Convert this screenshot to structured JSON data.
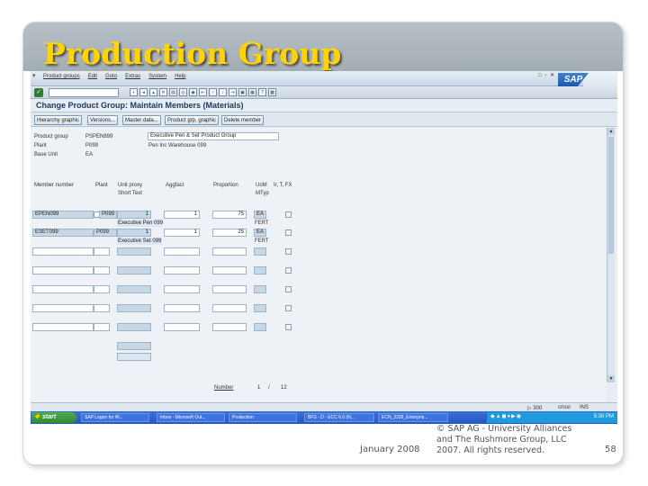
{
  "slide": {
    "title": "Production Group",
    "footer_date": "January 2008",
    "footer_copyright_lines": [
      "© SAP AG - University Alliances",
      "and The Rushmore Group, LLC",
      "2007. All rights reserved."
    ],
    "page_number": "58",
    "title_color": "#ffd400"
  },
  "menubar": {
    "items": [
      "Product groups",
      "Edit",
      "Goto",
      "Extras",
      "System",
      "Help"
    ],
    "window_controls": "□ ▫ ✕",
    "logo": "SAP"
  },
  "standard_toolbar": {
    "command_value": "",
    "icons": [
      "back-icon",
      "exit-icon",
      "cancel-icon",
      "print-icon",
      "find-icon",
      "find-next-icon",
      "first-page-icon",
      "prev-page-icon",
      "next-page-icon",
      "last-page-icon",
      "new-session-icon",
      "shortcut-icon",
      "help-icon",
      "layout-icon"
    ]
  },
  "screen": {
    "title": "Change Product Group: Maintain Members (Materials)"
  },
  "app_toolbar": {
    "buttons": [
      "Hierarchy graphic",
      "Versions...",
      "Master data...",
      "Product grp. graphic",
      "Delete member"
    ]
  },
  "header": {
    "product_group_label": "Product group",
    "product_group_value": "PSPEN899",
    "product_group_desc": "Executive Pen & Set Product Group",
    "plant_label": "Plant",
    "plant_value": "P099",
    "plant_desc": "Pen Inc Warehouse 099",
    "base_unit_label": "Base Unit",
    "base_unit_value": "EA"
  },
  "table": {
    "col_member": "Member number",
    "col_plant": "Plant",
    "col_unit_line1": "Unit proxy",
    "col_unit_line2": "Short Text",
    "col_aggfact": "Aggfact",
    "col_proportion": "Proportion",
    "col_uom_line1": "UoM",
    "col_uom_line2": "MTyp",
    "col_flags": "Ir, T, FX",
    "rows": [
      {
        "member": "EPEN099",
        "plant": "P099",
        "unit": "1",
        "aggfact": "1",
        "proportion": "75",
        "uom": "EA",
        "mtyp": "FERT",
        "short_text": "Executive Pen 099"
      },
      {
        "member": "ESET099",
        "plant": "P099",
        "unit": "1",
        "aggfact": "1",
        "proportion": "25",
        "uom": "EA",
        "mtyp": "FERT",
        "short_text": "Executive Set 099"
      }
    ],
    "pager_label": "Number",
    "pager_current": "1",
    "pager_of": "/",
    "pager_total": "12"
  },
  "statusbar": {
    "system": "▷ 300",
    "server": "crissi",
    "mode": "INS"
  },
  "taskbar": {
    "start": "start",
    "tasks": [
      "SAP Logon for W...",
      "Inbox - Microsoft Out...",
      "Production",
      "BFS - D - ECC 6.0 (N...",
      "ECN_2328_Enterpris..."
    ],
    "clock": "5:30 PM"
  }
}
